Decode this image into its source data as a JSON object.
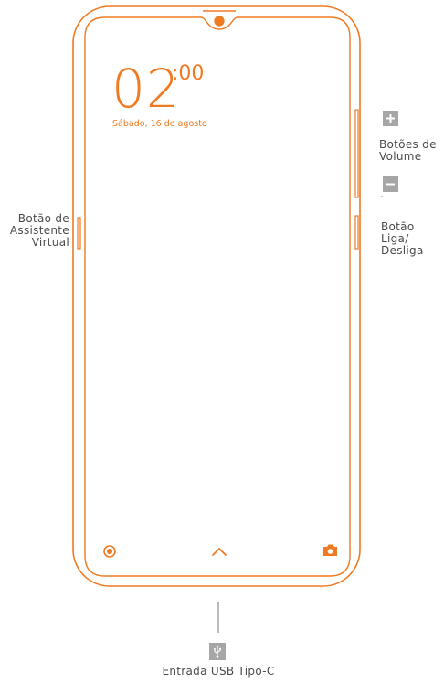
{
  "phone": {
    "time_hours": "02",
    "time_minutes": ":00",
    "date": "Sábado, 16 de agosto",
    "accent_color": "#f07a22",
    "nav_icons": [
      "record-icon",
      "chevron-up-icon",
      "camera-icon"
    ]
  },
  "callouts": {
    "assistant_button": [
      "Botão de",
      "Assistente",
      "Virtual"
    ],
    "volume_buttons": [
      "Botões de",
      "Volume"
    ],
    "power_button": [
      "Botão",
      "Liga/",
      "Desliga"
    ],
    "usb_port": "Entrada USB Tipo-C"
  },
  "icons": {
    "volume_up": "plus-icon",
    "volume_down": "minus-icon",
    "usb": "usb-icon"
  }
}
